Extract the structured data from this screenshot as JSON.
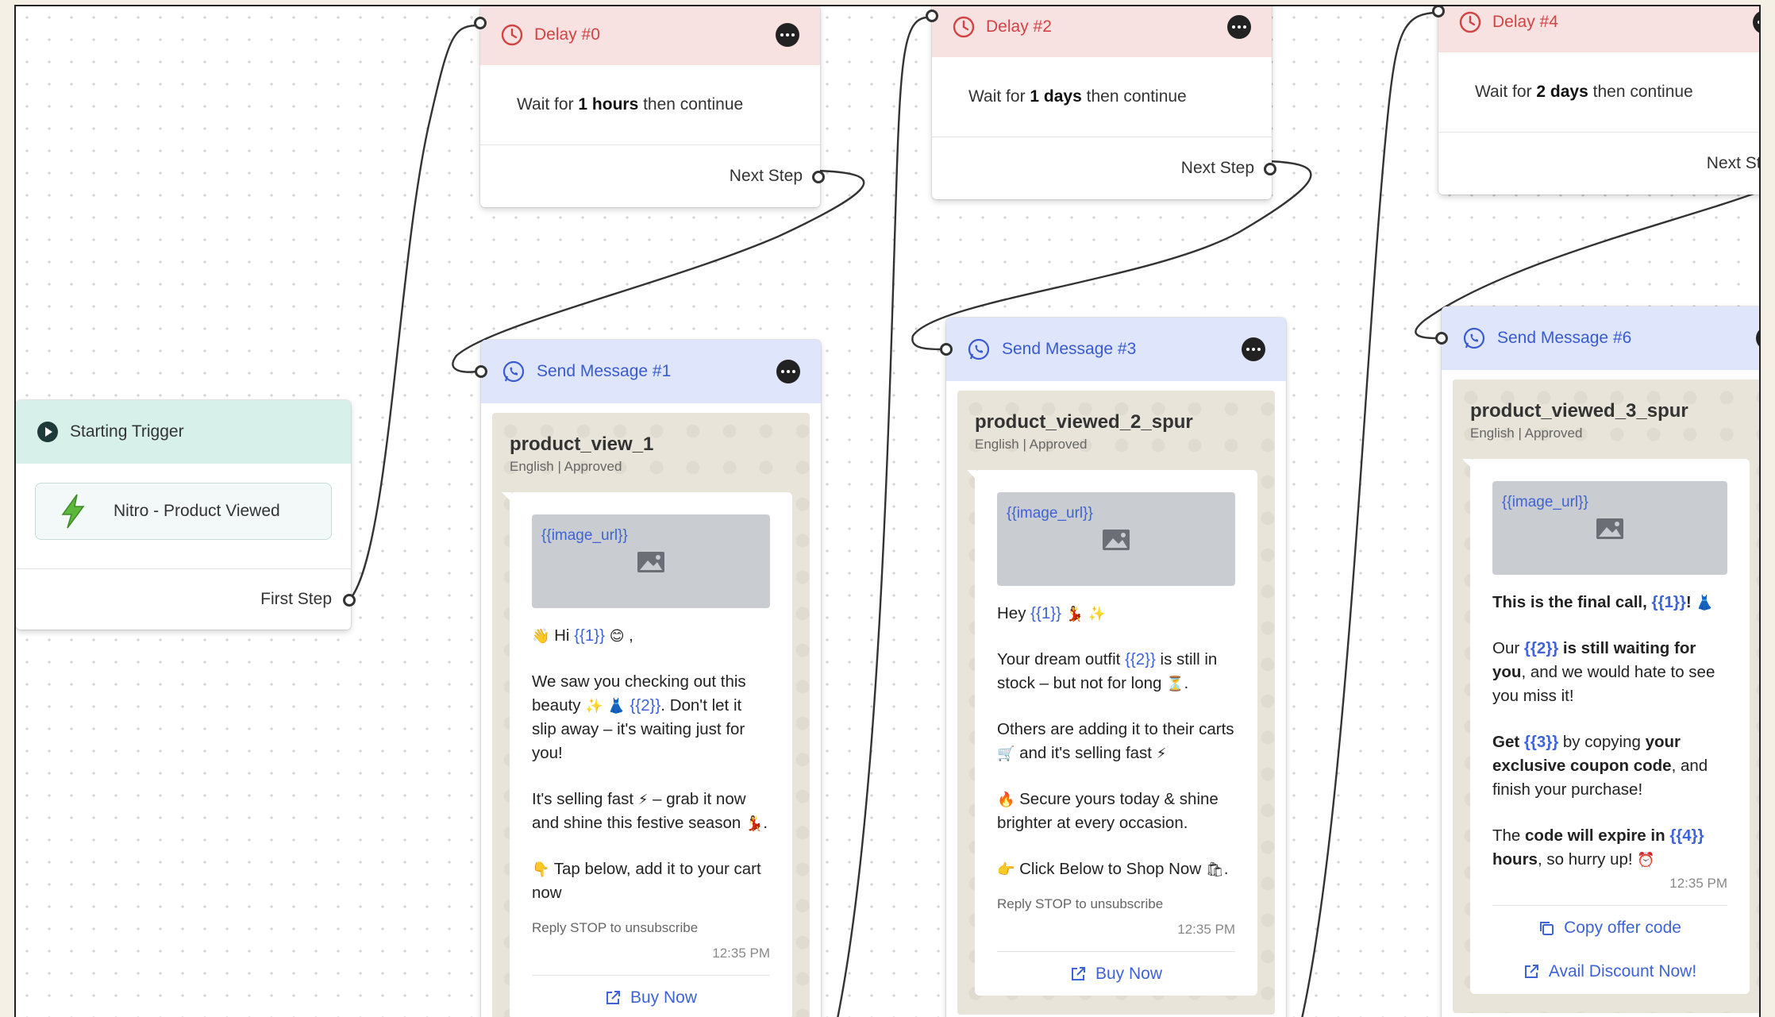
{
  "trigger": {
    "title": "Starting Trigger",
    "event": "Nitro - Product Viewed",
    "footer": "First Step"
  },
  "delays": [
    {
      "title": "Delay #0",
      "pre": "Wait for ",
      "amount": "1 hours",
      "post": " then continue",
      "footer": "Next Step"
    },
    {
      "title": "Delay #2",
      "pre": "Wait for ",
      "amount": "1 days",
      "post": " then continue",
      "footer": "Next Step"
    },
    {
      "title": "Delay #4",
      "pre": "Wait for ",
      "amount": "2 days",
      "post": " then continue",
      "footer": "Next Step"
    }
  ],
  "messages": [
    {
      "title": "Send Message #1",
      "template": "product_view_1",
      "meta": "English | Approved",
      "image_var": "{{image_url}}",
      "reply": "Reply STOP to unsubscribe",
      "time": "12:35 PM",
      "buttons": [
        "Buy Now"
      ]
    },
    {
      "title": "Send Message #3",
      "template": "product_viewed_2_spur",
      "meta": "English | Approved",
      "image_var": "{{image_url}}",
      "reply": "Reply STOP to unsubscribe",
      "time": "12:35 PM",
      "buttons": [
        "Buy Now"
      ]
    },
    {
      "title": "Send Message #6",
      "template": "product_viewed_3_spur",
      "meta": "English | Approved",
      "image_var": "{{image_url}}",
      "time": "12:35 PM",
      "buttons": [
        "Copy offer code",
        "Avail Discount Now!"
      ]
    }
  ],
  "m1": {
    "hi": "Hi ",
    "v1": "{{1}}",
    "p2a": "We saw you checking out this beauty ",
    "v2": "{{2}}",
    "p2b": ". Don't let it slip away – it's waiting just for you!",
    "p3a": "It's selling fast ",
    "p3b": " – grab it now and shine this festive season ",
    "p4": " Tap below, add it to your cart now"
  },
  "m3": {
    "hey": "Hey ",
    "v1": "{{1}}",
    "p2a": "Your dream outfit ",
    "v2": "{{2}}",
    "p2b": " is still in stock – but not for long ",
    "p3a": "Others are adding it to their carts ",
    "p3b": " and it's selling fast ",
    "p4": " Secure yours today & shine brighter at every occasion.",
    "p5": " Click Below to Shop Now "
  },
  "m6": {
    "p1a": "This is the final call, ",
    "v1": "{{1}}",
    "p2a": "Our ",
    "v2": "{{2}}",
    "p2b": " is still waiting for you",
    "p2c": ", and we would hate to see you miss it!",
    "p3a": "Get ",
    "v3": "{{3}}",
    "p3b": " by copying ",
    "p3c": "your exclusive coupon code",
    "p3d": ", and finish your purchase!",
    "p4a": "The ",
    "p4b": "code will expire in ",
    "v4": "{{4}}",
    "p4c": "hours",
    "p4d": ", so hurry up! "
  },
  "colors": {
    "delay_header": "#f7e1e1",
    "delay_accent": "#d14444",
    "message_header": "#dfe6fb",
    "message_accent": "#3a5bd0",
    "trigger_header": "#d8f0ea",
    "variable": "#3e63d6"
  }
}
